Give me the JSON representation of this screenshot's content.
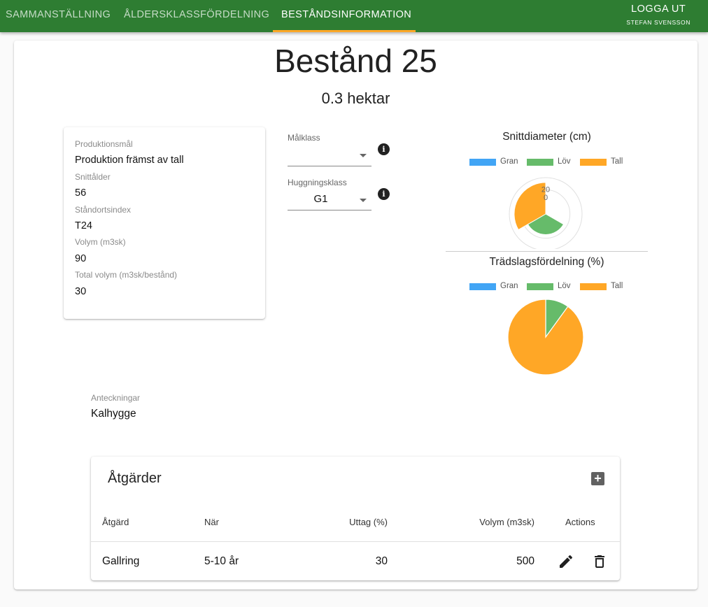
{
  "nav": {
    "tabs": [
      {
        "label": "SAMMANSTÄLLNING"
      },
      {
        "label": "ÅLDERSKLASSFÖRDELNING"
      },
      {
        "label": "BESTÅNDSINFORMATION"
      }
    ],
    "active_tab": 2,
    "logout_label": "LOGGA UT",
    "user_name": "STEFAN SVENSSON"
  },
  "stand": {
    "title": "Bestånd 25",
    "area": "0.3 hektar"
  },
  "info": {
    "fields": [
      {
        "label": "Produktionsmål",
        "value": "Produktion främst av tall"
      },
      {
        "label": "Snittålder",
        "value": "56"
      },
      {
        "label": "Ståndortsindex",
        "value": "T24"
      },
      {
        "label": "Volym (m3sk)",
        "value": "90"
      },
      {
        "label": "Total volym (m3sk/bestånd)",
        "value": "30"
      }
    ]
  },
  "selects": {
    "malklass": {
      "label": "Målklass",
      "value": ""
    },
    "huggningsklass": {
      "label": "Huggningsklass",
      "value": "G1"
    }
  },
  "colors": {
    "nav_bg": "#2e7d32",
    "accent": "#ffa726",
    "gran": "#42a5f5",
    "lov": "#66bb6a",
    "tall": "#ffa726"
  },
  "chart_data": [
    {
      "type": "polarArea",
      "title": "Snittdiameter (cm)",
      "legend": [
        "Gran",
        "Löv",
        "Tall"
      ],
      "legend_position": "top",
      "categories": [
        "Gran",
        "Löv",
        "Tall"
      ],
      "values": [
        0,
        17,
        26
      ],
      "r_ticks": [
        "20",
        "0"
      ],
      "r_max": 30
    },
    {
      "type": "pie",
      "title": "Trädslagsfördelning (%)",
      "legend": [
        "Gran",
        "Löv",
        "Tall"
      ],
      "legend_position": "top",
      "categories": [
        "Gran",
        "Löv",
        "Tall"
      ],
      "values": [
        0,
        10,
        90
      ]
    }
  ],
  "notes": {
    "label": "Anteckningar",
    "value": "Kalhygge"
  },
  "actions": {
    "title": "Åtgärder",
    "headers": [
      "Åtgärd",
      "När",
      "Uttag (%)",
      "Volym (m3sk)",
      "Actions"
    ],
    "rows": [
      {
        "atgard": "Gallring",
        "nar": "5-10 år",
        "uttag": "30",
        "volym": "500"
      }
    ]
  }
}
